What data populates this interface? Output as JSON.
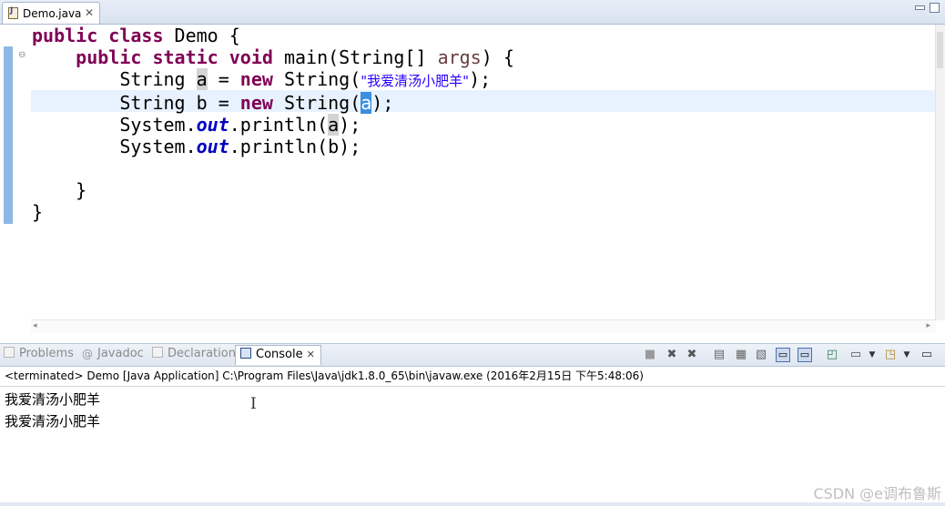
{
  "editor": {
    "tab_title": "Demo.java",
    "tab_close": "✕",
    "code": {
      "l1": {
        "kw1": "public",
        "kw2": "class",
        "rest": " Demo {"
      },
      "l2": {
        "kw1": "public",
        "kw2": "static",
        "kw3": "void",
        "mid": " main(String[] ",
        "param": "args",
        "end": ") {"
      },
      "l3": {
        "pre": "String ",
        "var": "a",
        "mid": " = ",
        "kw": "new",
        "call": " String(",
        "str": "\"我爱清汤小肥羊\"",
        "end": ");"
      },
      "l4": {
        "pre": "String b = ",
        "kw": "new",
        "call": " String(",
        "var": "a",
        "end": ");"
      },
      "l5": {
        "pre": "System.",
        "field": "out",
        "mid": ".println(",
        "var": "a",
        "end": ");"
      },
      "l6": {
        "pre": "System.",
        "field": "out",
        "mid": ".println(b);"
      },
      "l8": {
        "text": "}"
      },
      "l9": {
        "text": "}"
      }
    }
  },
  "views": {
    "tabs": [
      {
        "label": "Problems"
      },
      {
        "label": "Javadoc"
      },
      {
        "label": "Declaration"
      },
      {
        "label": "Console",
        "active": true
      }
    ],
    "console_close": "✕"
  },
  "console": {
    "description": "<terminated> Demo [Java Application] C:\\Program Files\\Java\\jdk1.8.0_65\\bin\\javaw.exe (2016年2月15日 下午5:48:06)",
    "output": [
      "我爱清汤小肥羊",
      "我爱清汤小肥羊"
    ]
  },
  "watermark": "CSDN @e调布鲁斯",
  "icons": [
    "java-file-icon",
    "close-icon",
    "minimize-icon",
    "maximize-icon",
    "fold-icon",
    "problems-icon",
    "javadoc-icon",
    "declaration-icon",
    "console-icon",
    "terminate-icon",
    "remove-launch-icon",
    "remove-all-icon",
    "clear-console-icon",
    "scroll-lock-icon",
    "word-wrap-icon",
    "show-on-stdout-icon",
    "show-on-stderr-icon",
    "pin-console-icon",
    "display-console-icon",
    "open-console-icon",
    "view-menu-icon"
  ],
  "colors": {
    "keyword": "#7f0055",
    "string": "#2a00ff",
    "field": "#0000c0",
    "selection": "#3a8fde",
    "current_line": "#e8f2fe"
  }
}
